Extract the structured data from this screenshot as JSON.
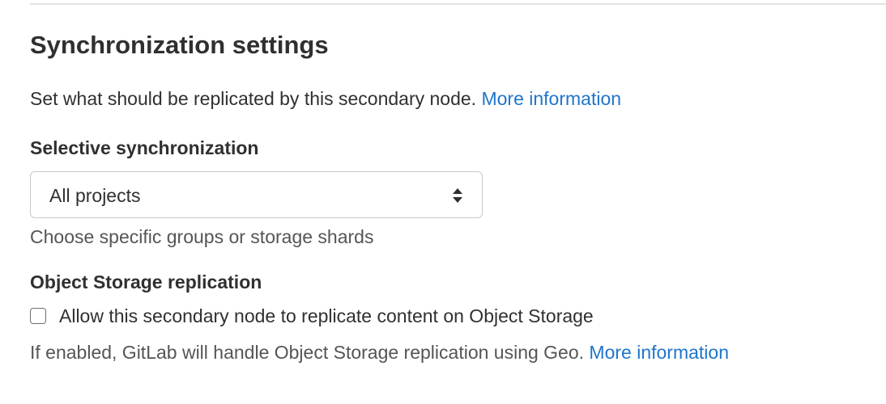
{
  "section": {
    "title": "Synchronization settings",
    "description": "Set what should be replicated by this secondary node.",
    "description_link": "More information"
  },
  "selective_sync": {
    "label": "Selective synchronization",
    "selected_value": "All projects",
    "help": "Choose specific groups or storage shards",
    "arrows_icon": "select-arrows-icon"
  },
  "object_storage": {
    "label": "Object Storage replication",
    "checkbox_label": "Allow this secondary node to replicate content on Object Storage",
    "checked": false,
    "help": "If enabled, GitLab will handle Object Storage replication using Geo.",
    "help_link": "More information"
  },
  "colors": {
    "link": "#1f75cb",
    "text": "#303030",
    "muted": "#555555",
    "border": "#c8c8cc"
  }
}
